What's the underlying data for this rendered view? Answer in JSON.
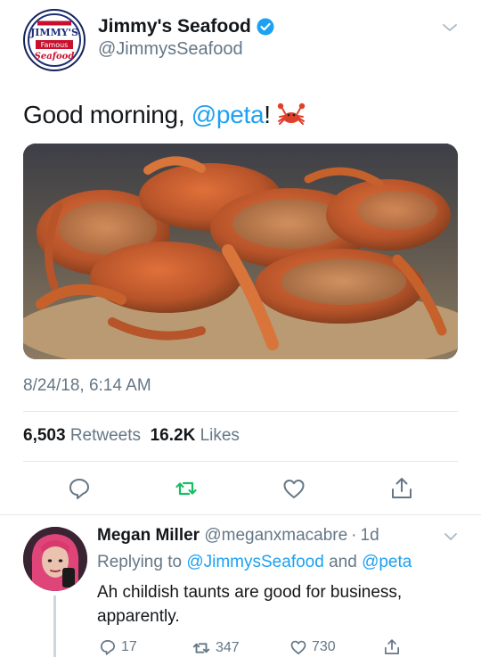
{
  "tweet": {
    "author_name": "Jimmy's Seafood",
    "author_handle": "@JimmysSeafood",
    "avatar_logo": {
      "line1": "JIMMY'S",
      "line2": "Famous",
      "line3": "Seafood"
    },
    "text_before": "Good morning, ",
    "mention": "@peta",
    "text_after": "!",
    "emoji": "crab",
    "timestamp": "8/24/18, 6:14 AM",
    "retweets_count": "6,503",
    "retweets_label": "Retweets",
    "likes_count": "16.2K",
    "likes_label": "Likes",
    "actions": [
      "reply-icon",
      "retweet-icon",
      "like-icon",
      "share-icon"
    ],
    "retweet_active_color": "#17bf63"
  },
  "reply": {
    "author_name": "Megan Miller",
    "author_handle": "@meganxmacabre",
    "separator": "·",
    "time": "1d",
    "replying_prefix": "Replying to",
    "replying_to_1": "@JimmysSeafood",
    "replying_joiner": "and",
    "replying_to_2": "@peta",
    "text": "Ah childish taunts are good for business, apparently.",
    "reply_count": "17",
    "retweet_count": "347",
    "like_count": "730"
  },
  "colors": {
    "accent": "#1da1f2",
    "muted": "#657786",
    "divider": "#e1e8ed",
    "verified": "#1da1f2"
  }
}
